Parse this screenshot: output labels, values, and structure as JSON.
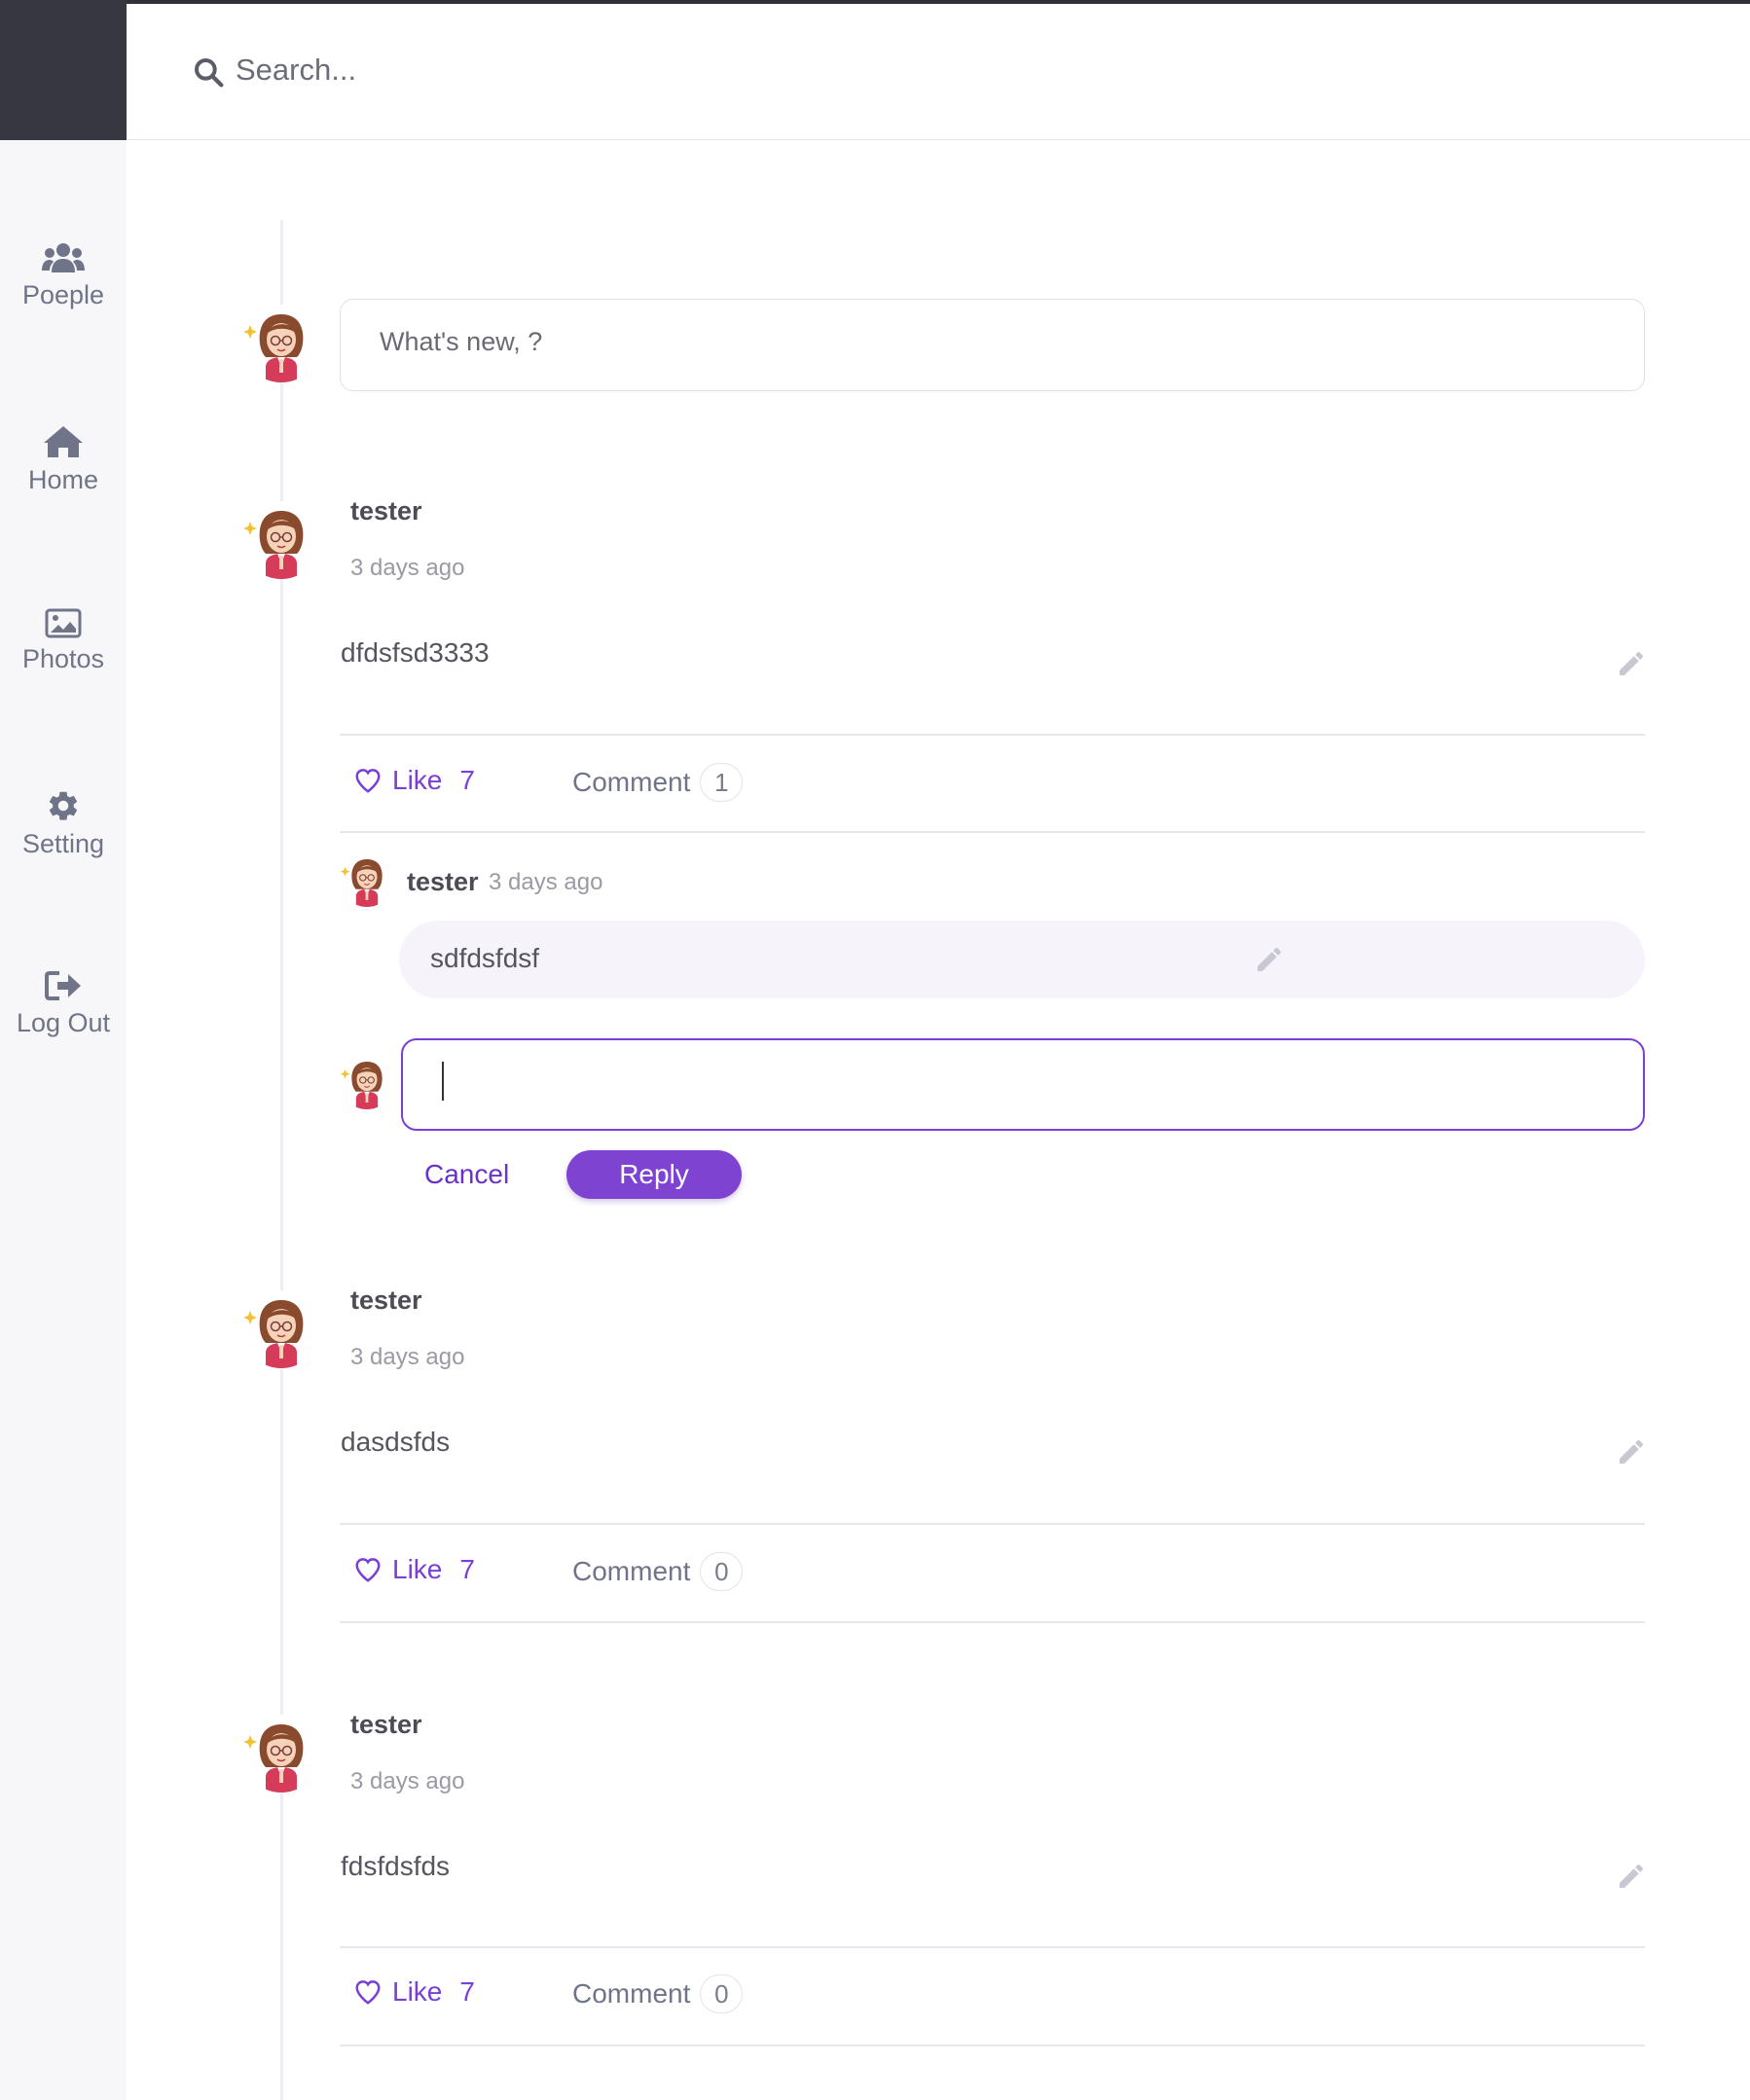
{
  "header": {
    "search_placeholder": "Search..."
  },
  "sidebar": {
    "items": [
      {
        "label": "Poeple",
        "icon": "users-icon"
      },
      {
        "label": "Home",
        "icon": "home-icon"
      },
      {
        "label": "Photos",
        "icon": "image-icon"
      },
      {
        "label": "Setting",
        "icon": "gear-icon"
      },
      {
        "label": "Log Out",
        "icon": "logout-icon"
      }
    ]
  },
  "composer": {
    "placeholder": "What's new, ?"
  },
  "posts": [
    {
      "author": "tester",
      "time": "3 days ago",
      "body": "dfdsfsd3333",
      "like_label": "Like",
      "likes": "7",
      "comment_label": "Comment",
      "comments": "1",
      "comment_list": [
        {
          "author": "tester",
          "time": "3 days ago",
          "body": "sdfdsfdsf"
        }
      ]
    },
    {
      "author": "tester",
      "time": "3 days ago",
      "body": "dasdsfds",
      "like_label": "Like",
      "likes": "7",
      "comment_label": "Comment",
      "comments": "0"
    },
    {
      "author": "tester",
      "time": "3 days ago",
      "body": "fdsfdsfds",
      "like_label": "Like",
      "likes": "7",
      "comment_label": "Comment",
      "comments": "0"
    }
  ],
  "reply_box": {
    "value": "",
    "cancel_label": "Cancel",
    "reply_label": "Reply"
  },
  "colors": {
    "accent": "#7e43d1",
    "sidebar_bg": "#f7f7fa",
    "corner_bg": "#363741"
  }
}
